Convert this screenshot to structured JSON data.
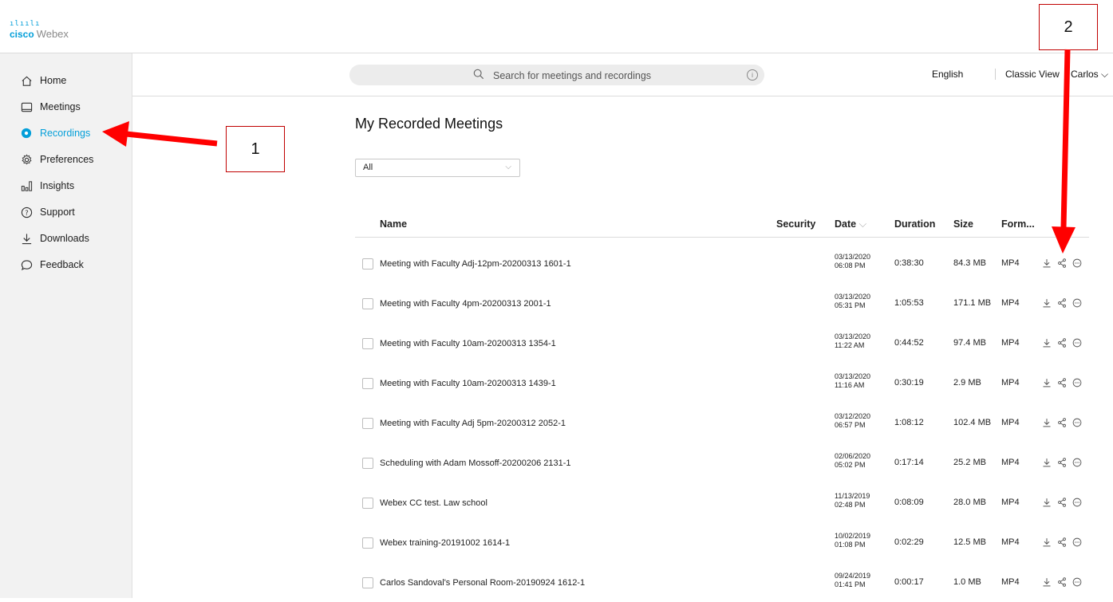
{
  "logo": {
    "cisco": "cisco",
    "webex": "Webex"
  },
  "sidebar": {
    "items": [
      {
        "label": "Home",
        "icon": "home-icon"
      },
      {
        "label": "Meetings",
        "icon": "meetings-icon"
      },
      {
        "label": "Recordings",
        "icon": "recordings-icon",
        "active": true
      },
      {
        "label": "Preferences",
        "icon": "gear-icon"
      },
      {
        "label": "Insights",
        "icon": "insights-icon"
      },
      {
        "label": "Support",
        "icon": "help-icon"
      },
      {
        "label": "Downloads",
        "icon": "download-icon"
      },
      {
        "label": "Feedback",
        "icon": "chat-icon"
      }
    ]
  },
  "header": {
    "search_placeholder": "Search for meetings and recordings",
    "language": "English",
    "classic_view": "Classic View",
    "user": "Carlos"
  },
  "main": {
    "title": "My Recorded Meetings",
    "filter_value": "All",
    "columns": {
      "name": "Name",
      "security": "Security",
      "date": "Date",
      "duration": "Duration",
      "size": "Size",
      "format": "Form..."
    },
    "rows": [
      {
        "name": "Meeting with Faculty Adj-12pm-20200313 1601-1",
        "date": "03/13/2020",
        "time": "06:08 PM",
        "duration": "0:38:30",
        "size": "84.3 MB",
        "format": "MP4"
      },
      {
        "name": "Meeting with Faculty 4pm-20200313 2001-1",
        "date": "03/13/2020",
        "time": "05:31 PM",
        "duration": "1:05:53",
        "size": "171.1 MB",
        "format": "MP4"
      },
      {
        "name": "Meeting with Faculty 10am-20200313 1354-1",
        "date": "03/13/2020",
        "time": "11:22 AM",
        "duration": "0:44:52",
        "size": "97.4 MB",
        "format": "MP4"
      },
      {
        "name": "Meeting with Faculty 10am-20200313 1439-1",
        "date": "03/13/2020",
        "time": "11:16 AM",
        "duration": "0:30:19",
        "size": "2.9 MB",
        "format": "MP4"
      },
      {
        "name": "Meeting with Faculty Adj 5pm-20200312 2052-1",
        "date": "03/12/2020",
        "time": "06:57 PM",
        "duration": "1:08:12",
        "size": "102.4 MB",
        "format": "MP4"
      },
      {
        "name": "Scheduling with Adam Mossoff-20200206 2131-1",
        "date": "02/06/2020",
        "time": "05:02 PM",
        "duration": "0:17:14",
        "size": "25.2 MB",
        "format": "MP4"
      },
      {
        "name": "Webex CC test. Law school",
        "date": "11/13/2019",
        "time": "02:48 PM",
        "duration": "0:08:09",
        "size": "28.0 MB",
        "format": "MP4"
      },
      {
        "name": "Webex training-20191002 1614-1",
        "date": "10/02/2019",
        "time": "01:08 PM",
        "duration": "0:02:29",
        "size": "12.5 MB",
        "format": "MP4"
      },
      {
        "name": "Carlos Sandoval's Personal Room-20190924 1612-1",
        "date": "09/24/2019",
        "time": "01:41 PM",
        "duration": "0:00:17",
        "size": "1.0 MB",
        "format": "MP4"
      }
    ]
  },
  "annotations": {
    "callout_1": "1",
    "callout_2": "2",
    "arrow_color": "#ff0000"
  },
  "colors": {
    "accent": "#049fd9"
  }
}
